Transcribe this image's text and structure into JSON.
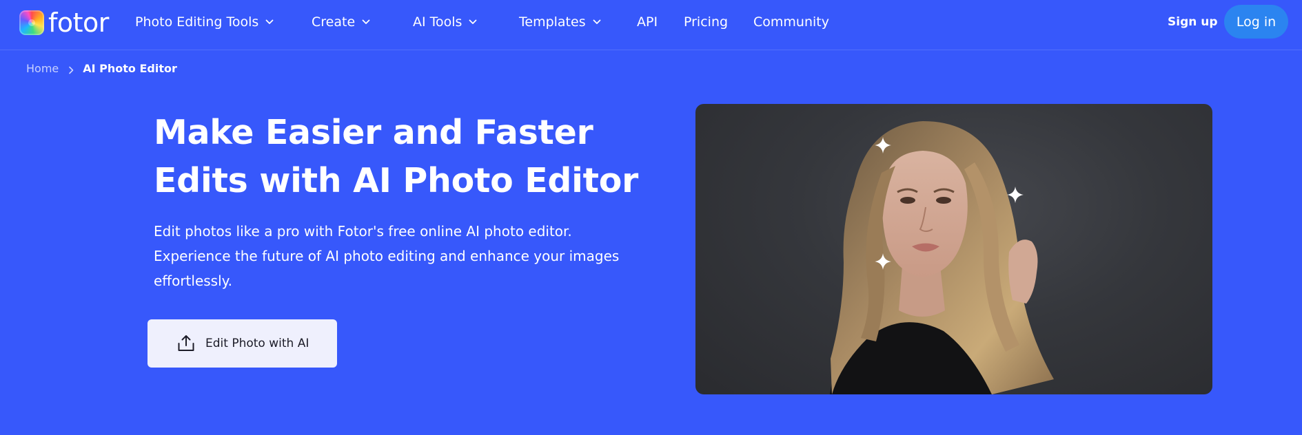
{
  "brand": {
    "name": "fotor"
  },
  "nav": {
    "items": [
      {
        "label": "Photo Editing Tools",
        "has_dropdown": true
      },
      {
        "label": "Create",
        "has_dropdown": true
      },
      {
        "label": "AI Tools",
        "has_dropdown": true
      },
      {
        "label": "Templates",
        "has_dropdown": true
      },
      {
        "label": "API",
        "has_dropdown": false
      },
      {
        "label": "Pricing",
        "has_dropdown": false
      },
      {
        "label": "Community",
        "has_dropdown": false
      }
    ],
    "signup_label": "Sign up",
    "login_label": "Log in"
  },
  "breadcrumb": {
    "home": "Home",
    "current": "AI Photo Editor"
  },
  "hero": {
    "title": "Make Easier and Faster Edits with AI Photo Editor",
    "description": "Edit photos like a pro with Fotor's free online AI photo editor. Experience the future of AI photo editing and enhance your images effortlessly.",
    "cta_label": "Edit Photo with AI",
    "cta_icon": "upload-icon"
  },
  "colors": {
    "background": "#3758fb",
    "login_button": "#2b84f0",
    "cta_background": "#eff0fd",
    "image_backdrop": "#35373c"
  }
}
